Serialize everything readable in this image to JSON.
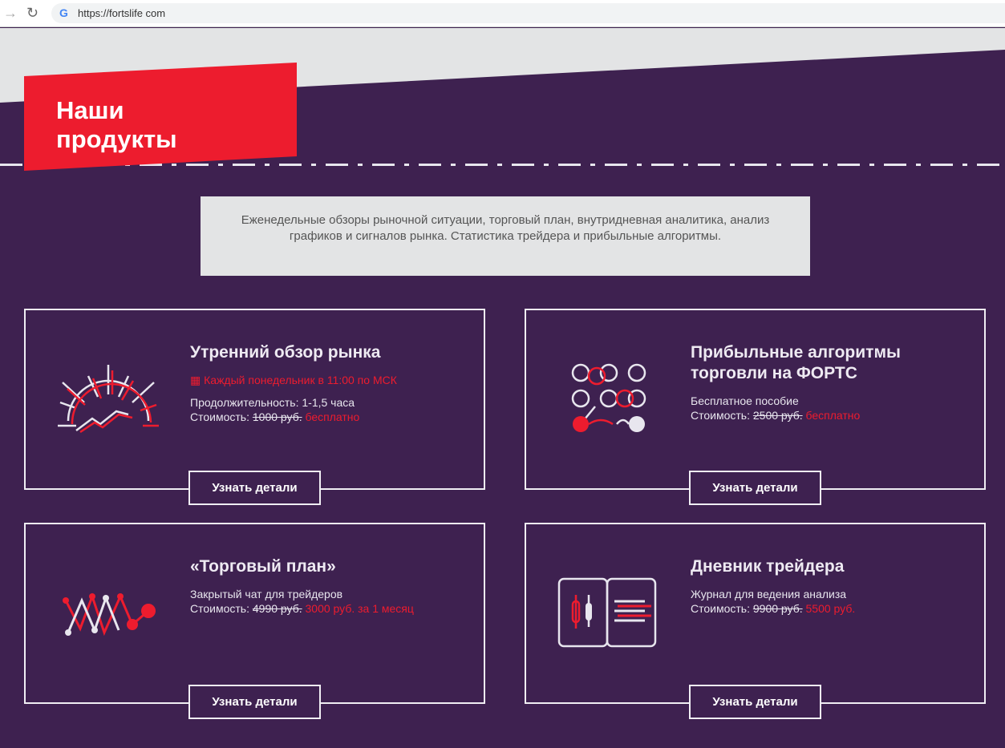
{
  "browser": {
    "url": "https://fortslife com"
  },
  "section_title_1": "Наши",
  "section_title_2": "продукты",
  "description": "Еженедельные обзоры рыночной ситуации, торговый план, внутридневная аналитика, анализ графиков и сигналов рынка. Статистика трейдера и прибыльные алгоритмы.",
  "products": [
    {
      "title": "Утренний обзор рынка",
      "schedule": "Каждый понедельник в 11:00 по МСК",
      "line1": "Продолжительность: 1-1,5 часа",
      "cost_label": "Стоимость:",
      "old_price": "1000 руб.",
      "new_price": "бесплатно",
      "button": "Узнать детали"
    },
    {
      "title": "Прибыльные алгоритмы торговли на ФОРТС",
      "line1": "Бесплатное пособие",
      "cost_label": "Стоимость:",
      "old_price": "2500 руб.",
      "new_price": "бесплатно",
      "button": "Узнать детали"
    },
    {
      "title": "«Торговый план»",
      "line1": "Закрытый чат для трейдеров",
      "cost_label": "Стоимость:",
      "old_price": "4990 руб.",
      "new_price": "3000 руб. за 1 месяц",
      "button": "Узнать детали"
    },
    {
      "title": "Дневник трейдера",
      "line1": "Журнал для ведения анализа",
      "cost_label": "Стоимость:",
      "old_price": "9900 руб.",
      "new_price": "5500 руб.",
      "button": "Узнать детали"
    }
  ],
  "colors": {
    "accent": "#ed1c2e",
    "background": "#3e2150",
    "light": "#e3e4e5"
  }
}
